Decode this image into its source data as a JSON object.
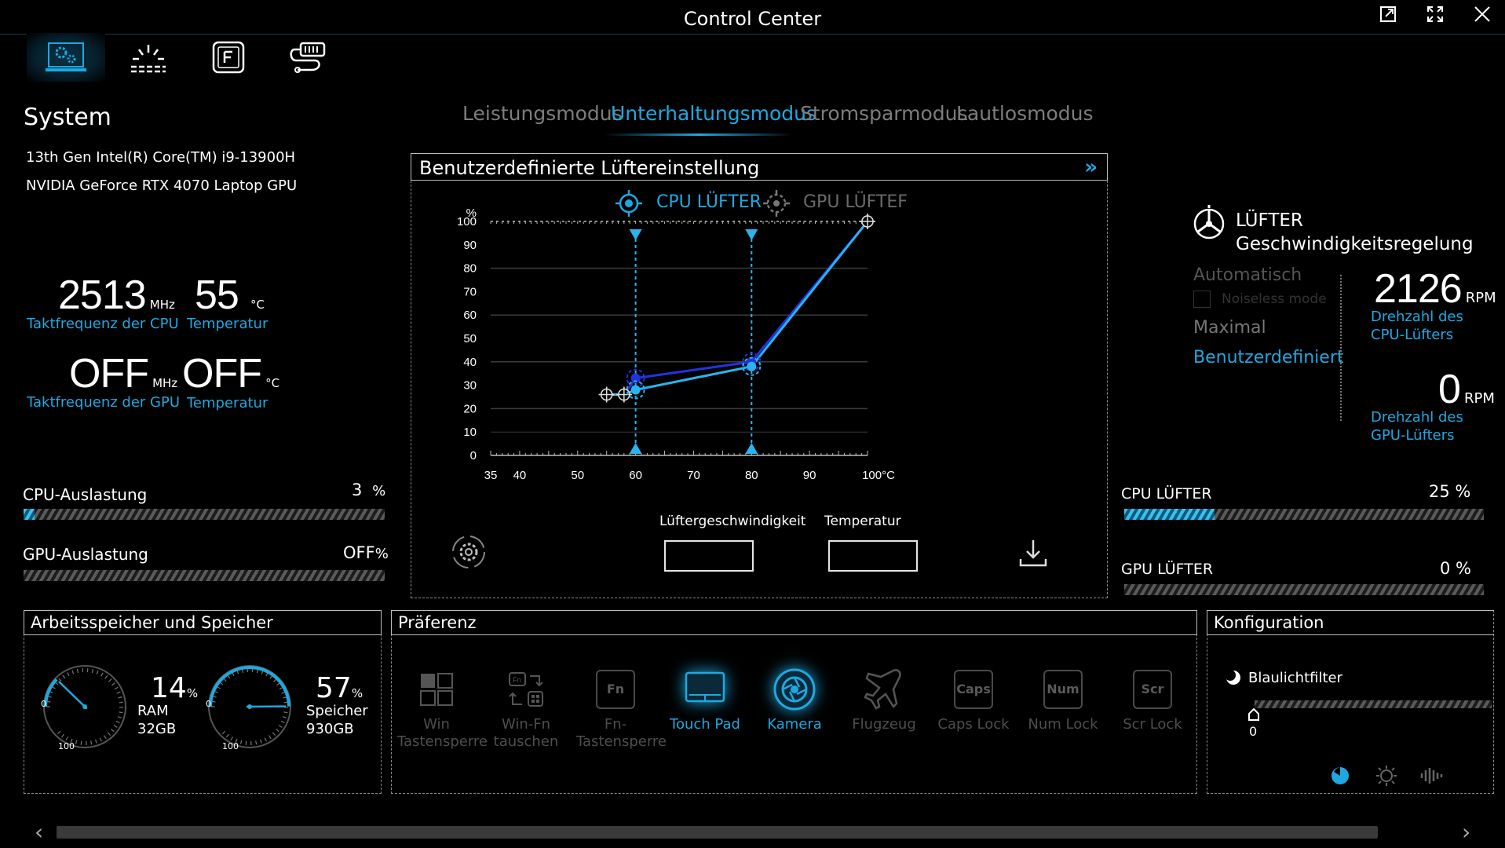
{
  "app_title": "Control Center",
  "nav": [
    {
      "name": "system-gear-icon"
    },
    {
      "name": "lighting-icon"
    },
    {
      "name": "function-key-icon"
    },
    {
      "name": "network-icon"
    }
  ],
  "modes": {
    "items": [
      "Leistungsmodus",
      "Unterhaltungsmodus",
      "Stromsparmodus",
      "Lautlosmodus"
    ],
    "active": "Unterhaltungsmodus"
  },
  "system": {
    "title": "System",
    "cpu_name": "13th Gen Intel(R) Core(TM) i9-13900H",
    "gpu_name": "NVIDIA GeForce RTX 4070 Laptop GPU",
    "cpu_clock": {
      "value": "2513",
      "unit": "MHz",
      "label": "Taktfrequenz der CPU"
    },
    "cpu_temp": {
      "value": "55",
      "unit": "°C",
      "label": "Temperatur"
    },
    "gpu_clock": {
      "value": "OFF",
      "unit": "MHz",
      "label": "Taktfrequenz der GPU"
    },
    "gpu_temp": {
      "value": "OFF",
      "unit": "°C",
      "label": "Temperatur"
    },
    "cpu_load": {
      "label": "CPU-Auslastung",
      "value": "3",
      "unit": "%",
      "fraction": 0.03
    },
    "gpu_load": {
      "label": "GPU-Auslastung",
      "value": "OFF",
      "unit": "%",
      "fraction": 0
    }
  },
  "fan_panel": {
    "title": "Benutzerdefinierte Lüftereinstellung",
    "legend_cpu": "CPU LÜFTER",
    "legend_gpu": "GPU LÜFTEF",
    "fan_speed_label": "Lüftergeschwindigkeit",
    "temperature_label": "Temperatur",
    "fan_speed_value": "",
    "temperature_value": ""
  },
  "chart_data": {
    "type": "line",
    "y_unit_label": "%",
    "x_ticks": [
      "35",
      "40",
      "50",
      "60",
      "70",
      "80",
      "90",
      "100°C"
    ],
    "x_tick_values": [
      35,
      40,
      50,
      60,
      70,
      80,
      90,
      100
    ],
    "y_ticks": [
      0,
      10,
      20,
      30,
      40,
      50,
      60,
      70,
      80,
      90,
      100
    ],
    "xlim": [
      35,
      100
    ],
    "ylim": [
      0,
      100
    ],
    "series": [
      {
        "name": "CPU LÜFTER",
        "color": "#2ab4ee",
        "points": [
          [
            55,
            26
          ],
          [
            58,
            26
          ],
          [
            60,
            28
          ],
          [
            80,
            38
          ],
          [
            100,
            100
          ]
        ]
      },
      {
        "name": "GPU LÜFTER",
        "color": "#2233dd",
        "points": [
          [
            55,
            26
          ],
          [
            58,
            26
          ],
          [
            60,
            33
          ],
          [
            80,
            40
          ],
          [
            100,
            100
          ]
        ]
      }
    ],
    "markers_x": [
      60,
      80
    ]
  },
  "fan_control": {
    "title_line1": "LÜFTER",
    "title_line2": "Geschwindigkeitsregelung",
    "options": [
      "Automatisch",
      "Maximal",
      "Benutzerdefiniert"
    ],
    "noiseless": "Noiseless mode",
    "active": "Benutzerdefiniert",
    "cpu_rpm": {
      "value": "2126",
      "unit": "RPM",
      "label": "Drehzahl des CPU-Lüfters"
    },
    "gpu_rpm": {
      "value": "0",
      "unit": "RPM",
      "label": "Drehzahl des GPU-Lüfters"
    },
    "cpu_fan": {
      "label": "CPU LÜFTER",
      "value": "25 %",
      "fraction": 0.25
    },
    "gpu_fan": {
      "label": "GPU LÜFTER",
      "value": "0 %",
      "fraction": 0
    }
  },
  "memory": {
    "title": "Arbeitsspeicher und Speicher",
    "ram": {
      "value": "14",
      "unit": "%",
      "label": "RAM",
      "size": "32GB",
      "fraction": 0.14
    },
    "storage": {
      "value": "57",
      "unit": "%",
      "label": "Speicher",
      "size": "930GB",
      "fraction": 0.57
    },
    "gauge_min": "0",
    "gauge_max": "100"
  },
  "preference": {
    "title": "Präferenz",
    "items": [
      {
        "line1": "Win",
        "line2": "Tastensperre",
        "icon": "windows-icon",
        "on": false
      },
      {
        "line1": "Win-Fn",
        "line2": "tauschen",
        "icon": "swap-icon",
        "on": false
      },
      {
        "line1": "Fn-",
        "line2": "Tastensperre",
        "icon": "fn-key-icon",
        "key": "Fn",
        "on": false
      },
      {
        "line1": "Touch Pad",
        "line2": "",
        "icon": "touchpad-icon",
        "on": true
      },
      {
        "line1": "Kamera",
        "line2": "",
        "icon": "camera-icon",
        "on": true
      },
      {
        "line1": "Flugzeug",
        "line2": "",
        "icon": "airplane-icon",
        "on": false
      },
      {
        "line1": "Caps Lock",
        "line2": "",
        "icon": "caps-lock-icon",
        "key": "Caps",
        "on": false
      },
      {
        "line1": "Num Lock",
        "line2": "",
        "icon": "num-lock-icon",
        "key": "Num",
        "on": false
      },
      {
        "line1": "Scr Lock",
        "line2": "",
        "icon": "scroll-lock-icon",
        "key": "Scr",
        "on": false
      }
    ]
  },
  "config": {
    "title": "Konfiguration",
    "blue_light_label": "Blaulichtfilter",
    "blue_light_value": "0",
    "blue_light_fraction": 0
  }
}
